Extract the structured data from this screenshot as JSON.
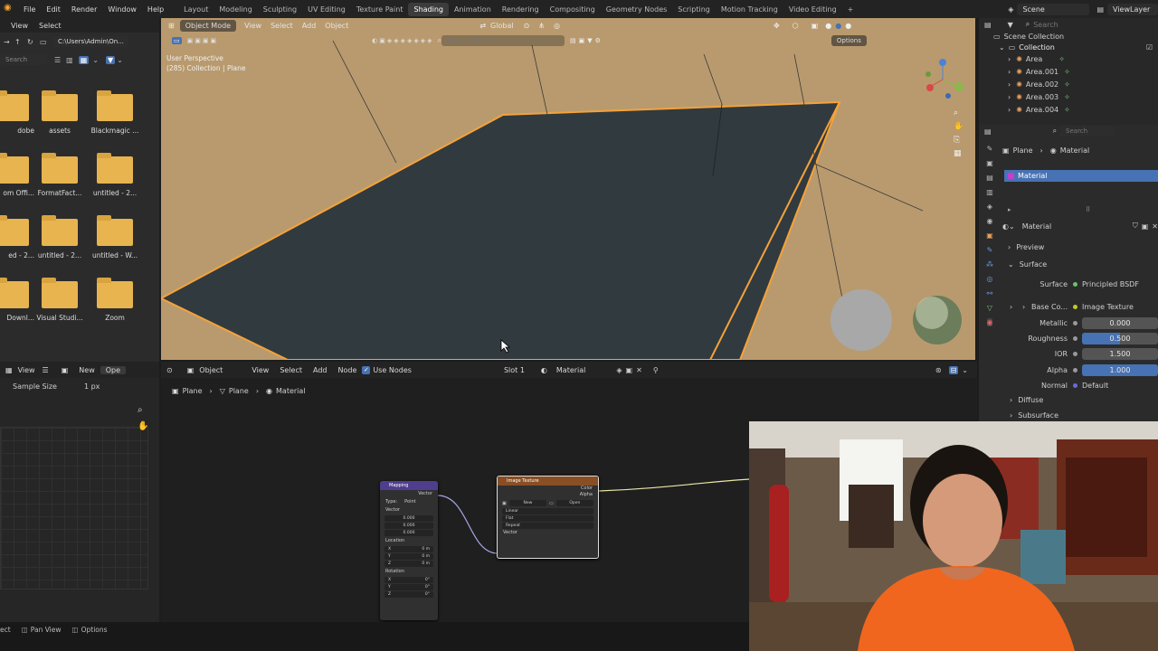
{
  "topbar": {
    "menus": [
      "File",
      "Edit",
      "Render",
      "Window",
      "Help"
    ],
    "workspaces": [
      "Layout",
      "Modeling",
      "Sculpting",
      "UV Editing",
      "Texture Paint",
      "Shading",
      "Animation",
      "Rendering",
      "Compositing",
      "Geometry Nodes",
      "Scripting",
      "Motion Tracking",
      "Video Editing"
    ],
    "active_workspace": "Shading",
    "add_tab": "+",
    "scene": "Scene",
    "view_layer": "ViewLayer"
  },
  "filebrowser": {
    "view": "View",
    "select": "Select",
    "path": "C:\\Users\\Admin\\On...",
    "search_placeholder": "Search",
    "folders": [
      "dobe",
      "assets",
      "Blackmagic ...",
      "om Offi...",
      "FormatFact...",
      "untitled - 2...",
      "ed - 2...",
      "untitled - 2...",
      "untitled - W...",
      "Downl...",
      "Visual Studi...",
      "Zoom"
    ]
  },
  "viewport": {
    "mode": "Object Mode",
    "menus": [
      "View",
      "Select",
      "Add",
      "Object"
    ],
    "orientation": "Global",
    "search_placeholder": "Search Blendkit",
    "options": "Options",
    "overlay_title": "User Perspective",
    "overlay_sub": "(285) Collection | Plane"
  },
  "nodeeditor": {
    "editor_menu_object": "Object",
    "menus": [
      "View",
      "Select",
      "Add",
      "Node"
    ],
    "use_nodes": "Use Nodes",
    "slot": "Slot 1",
    "material": "Material",
    "breadcrumb": [
      "Plane",
      "Plane",
      "Material"
    ],
    "mapping_node": {
      "title": "Mapping",
      "output": "Vector",
      "type_label": "Type:",
      "type_value": "Point",
      "vector_label": "Vector",
      "vector_values": [
        "0.000",
        "0.000",
        "0.000"
      ],
      "location_label": "Location",
      "location_axes": [
        "X",
        "Y",
        "Z"
      ],
      "location_values": [
        "0 m",
        "0 m",
        "0 m"
      ],
      "rotation_label": "Rotation",
      "rotation_axes": [
        "X",
        "Y",
        "Z"
      ],
      "rotation_values": [
        "0°",
        "0°",
        "0°"
      ]
    },
    "image_node": {
      "title": "Image Texture",
      "outputs": [
        "Color",
        "Alpha"
      ],
      "new": "New",
      "open": "Open",
      "interp": "Linear",
      "proj": "Flat",
      "ext": "Repeat",
      "input": "Vector"
    }
  },
  "imgeditor": {
    "view": "View",
    "new": "New",
    "open": "Ope",
    "sample_size_label": "Sample Size",
    "sample_size_value": "1 px"
  },
  "outliner": {
    "search_placeholder": "Search",
    "root": "Scene Collection",
    "collection": "Collection",
    "items": [
      "Area",
      "Area.001",
      "Area.002",
      "Area.003",
      "Area.004"
    ]
  },
  "properties": {
    "search_placeholder": "Search",
    "breadcrumb_object": "Plane",
    "breadcrumb_material": "Material",
    "slot_material": "Material",
    "material_name": "Material",
    "preview": "Preview",
    "surface_section": "Surface",
    "surface_label": "Surface",
    "surface_value": "Principled BSDF",
    "base_color_label": "Base Co...",
    "base_color_value": "Image Texture",
    "metallic_label": "Metallic",
    "metallic_value": "0.000",
    "roughness_label": "Roughness",
    "roughness_value": "0.500",
    "roughness_fraction": 0.5,
    "ior_label": "IOR",
    "ior_value": "1.500",
    "alpha_label": "Alpha",
    "alpha_value": "1.000",
    "alpha_fraction": 1.0,
    "normal_label": "Normal",
    "normal_value": "Default",
    "diffuse": "Diffuse",
    "subsurface": "Subsurface"
  },
  "statusbar": {
    "select": "ect",
    "pan": "Pan View",
    "options": "Options"
  },
  "colors": {
    "accent_blue": "#4772b3",
    "selection_orange": "#f5a23a",
    "material_pink": "#c83ec8",
    "folder_yellow": "#e8b44f"
  }
}
